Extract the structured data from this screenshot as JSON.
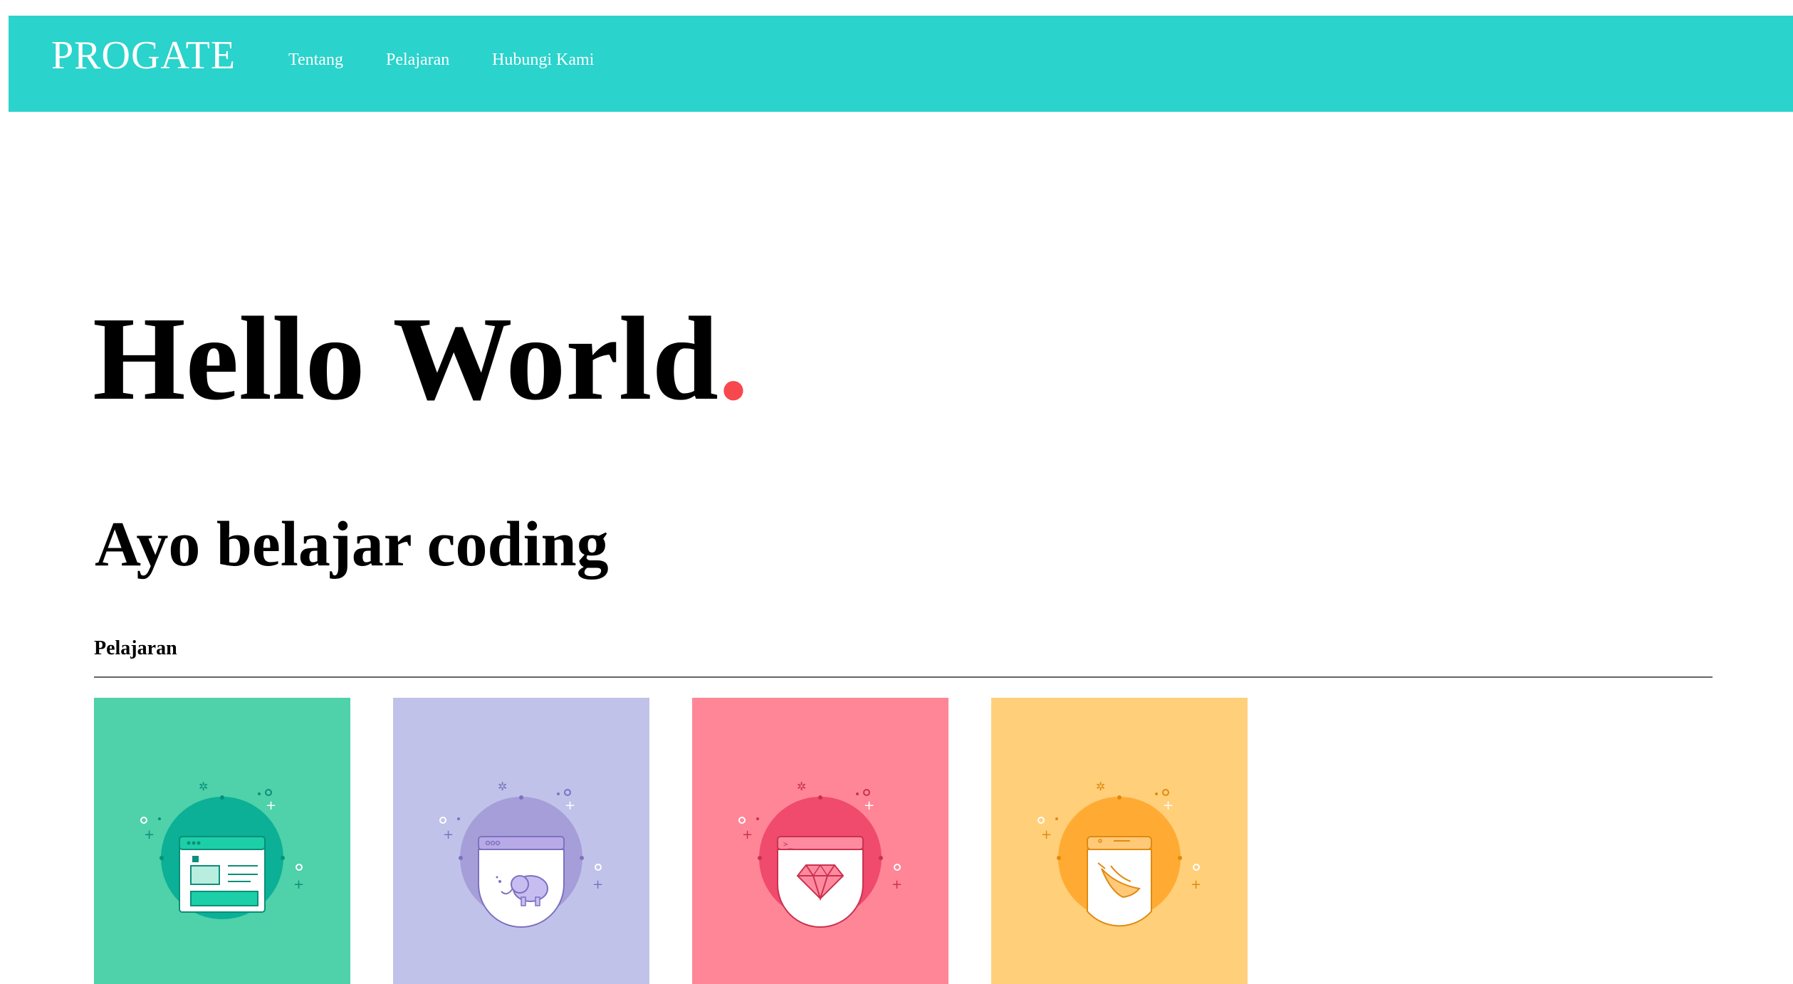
{
  "header": {
    "logo": "PROGATE",
    "nav": [
      {
        "label": "Tentang"
      },
      {
        "label": "Pelajaran"
      },
      {
        "label": "Hubungi Kami"
      }
    ],
    "color": "#2ad3cb"
  },
  "hero": {
    "title": "Hello World",
    "title_dot": ".",
    "dot_color": "#f7484e",
    "subtitle": "Ayo belajar coding"
  },
  "lessons": {
    "heading": "Pelajaran",
    "cards": [
      {
        "icon": "html-css-icon",
        "bg": "#4fd1aa",
        "circle": "#0bb096",
        "accent": "#1dcfa8"
      },
      {
        "icon": "php-elephant-icon",
        "bg": "#c1c2ea",
        "circle": "#a69ed8",
        "accent": "#b8aae6"
      },
      {
        "icon": "ruby-gem-icon",
        "bg": "#ff8696",
        "circle": "#f04a6c",
        "accent": "#ff8aa0"
      },
      {
        "icon": "swift-icon",
        "bg": "#ffcf7a",
        "circle": "#ffab33",
        "accent": "#ffc978"
      }
    ]
  }
}
